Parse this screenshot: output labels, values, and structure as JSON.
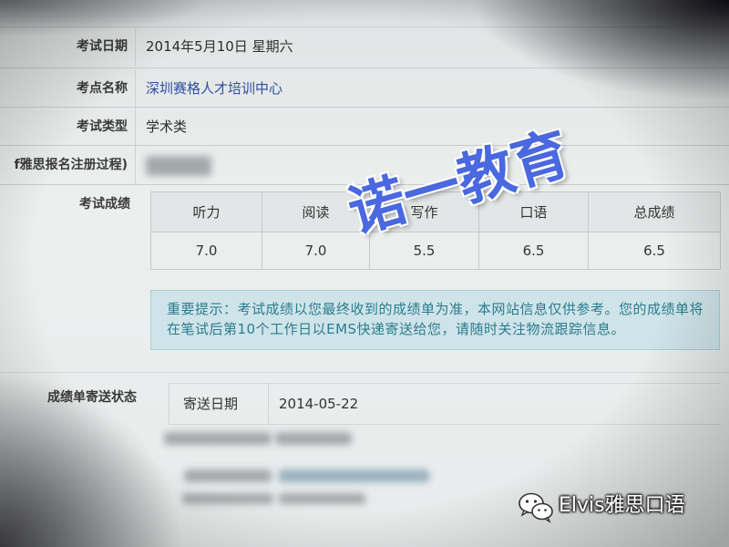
{
  "info_rows": [
    {
      "label": "考试日期",
      "value": "2014年5月10日 星期六"
    },
    {
      "label": "考点名称",
      "value": "深圳赛格人才培训中心"
    },
    {
      "label": "考试类型",
      "value": "学术类"
    },
    {
      "label": "f雅思报名注册过程)"
    }
  ],
  "scores": {
    "label": "考试成绩",
    "headers": [
      "听力",
      "阅读",
      "写作",
      "口语",
      "总成绩"
    ],
    "values": [
      "7.0",
      "7.0",
      "5.5",
      "6.5",
      "6.5"
    ]
  },
  "notice": {
    "line1": "重要提示：考试成绩以您最终收到的成绩单为准，本网站信息仅供参考。您的成绩单将",
    "line2": "在笔试后第10个工作日以EMS快递寄送给您，请随时关注物流跟踪信息。"
  },
  "delivery": {
    "label": "成绩单寄送状态",
    "date_label": "寄送日期",
    "date_value": "2014-05-22"
  },
  "watermark": "诺一教育",
  "wechat_account": "Elvis雅思口语",
  "colors": {
    "link": "#2f4fa0",
    "watermark": "#4a68df",
    "notice_bg": "#cfe4e9",
    "notice_text": "#2c7c8e"
  }
}
